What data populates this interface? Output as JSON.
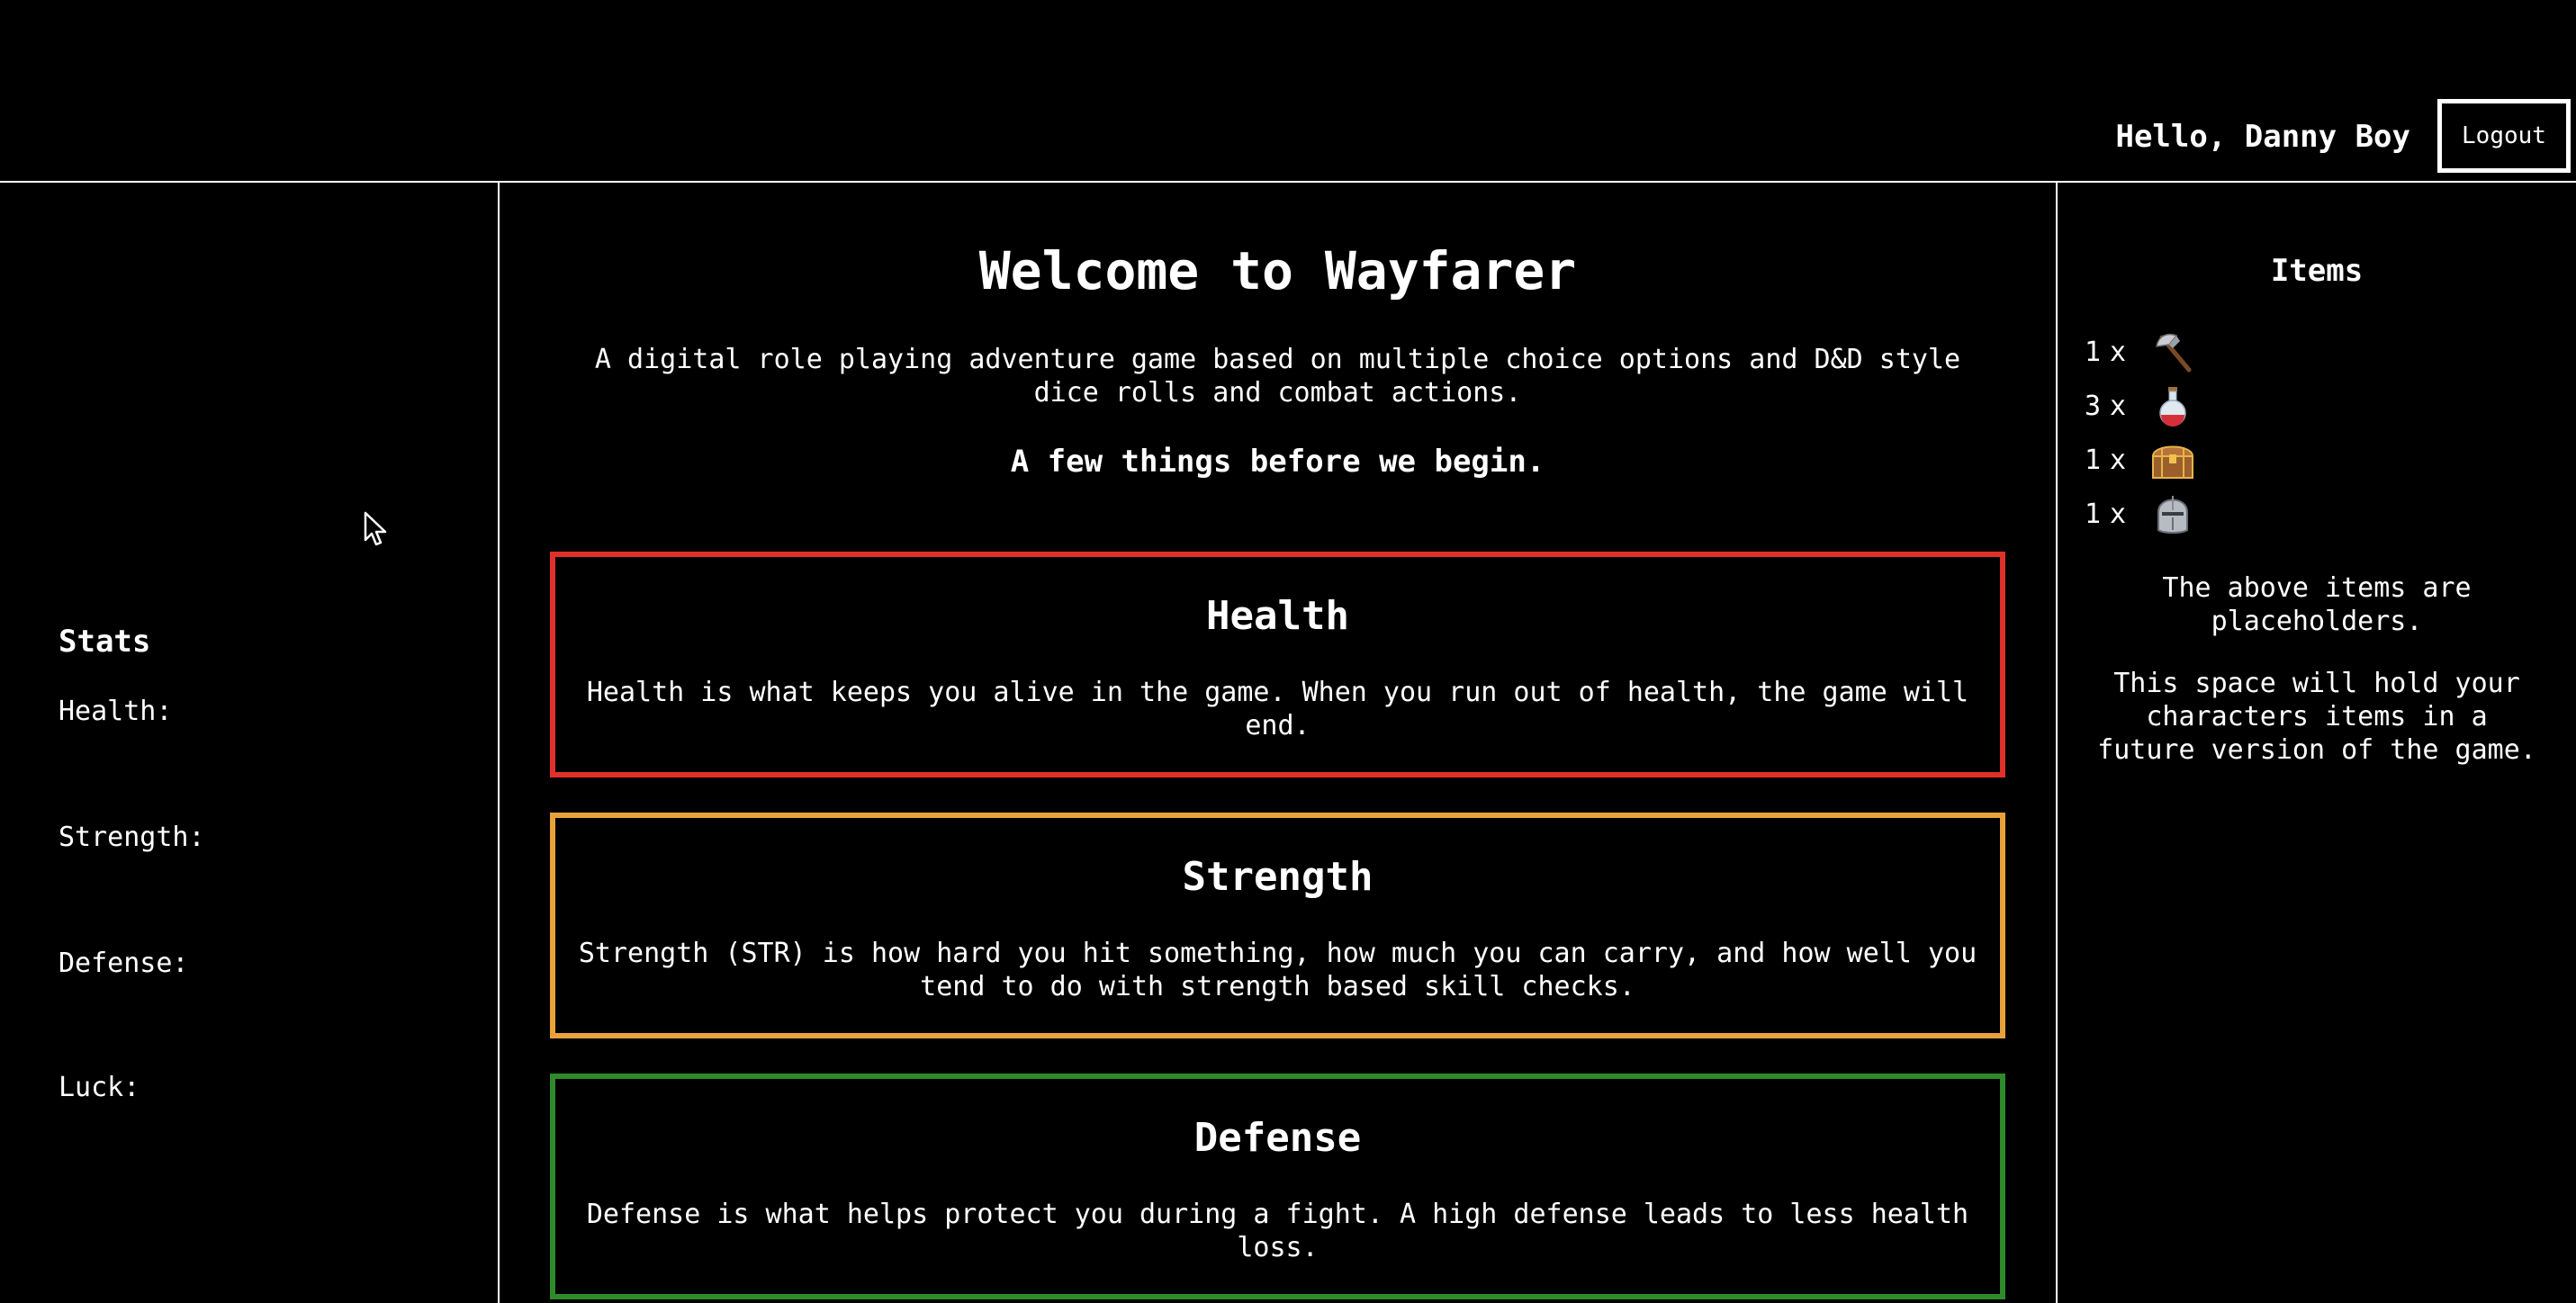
{
  "header": {
    "greeting": "Hello, Danny Boy",
    "logout_label": "Logout"
  },
  "stats": {
    "title": "Stats",
    "labels": [
      "Health:",
      "Strength:",
      "Defense:",
      "Luck:"
    ]
  },
  "main": {
    "title": "Welcome to Wayfarer",
    "subtitle": "A digital role playing adventure game based on multiple choice options and D&D style dice rolls and combat actions.",
    "lead": "A few things before we begin.",
    "cards": [
      {
        "title": "Health",
        "body": "Health is what keeps you alive in the game. When you run out of health, the game will end.",
        "color": "#e0302a"
      },
      {
        "title": "Strength",
        "body": "Strength (STR) is how hard you hit something, how much you can carry, and how well you tend to do with strength based skill checks.",
        "color": "#e9a23b"
      },
      {
        "title": "Defense",
        "body": "Defense is what helps protect you during a fight. A high defense leads to less health loss.",
        "color": "#2f8a2a"
      }
    ]
  },
  "items": {
    "title": "Items",
    "list": [
      {
        "qty": "1",
        "x": "x",
        "icon": "axe-icon"
      },
      {
        "qty": "3",
        "x": "x",
        "icon": "potion-icon"
      },
      {
        "qty": "1",
        "x": "x",
        "icon": "chest-icon"
      },
      {
        "qty": "1",
        "x": "x",
        "icon": "helmet-icon"
      }
    ],
    "note1": "The above items are placeholders.",
    "note2": "This space will hold your characters items in a future version of the game."
  }
}
